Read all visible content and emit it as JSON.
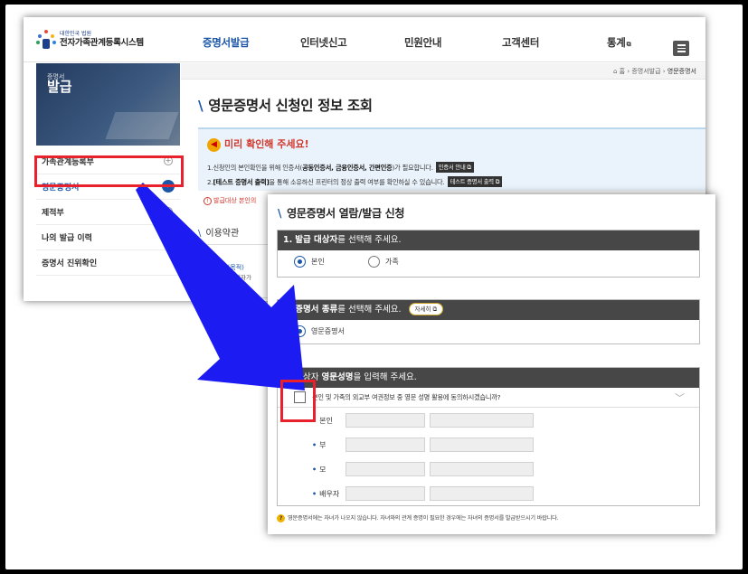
{
  "header": {
    "logo_small": "대한민국 법원",
    "logo_title": "전자가족관계등록시스템",
    "nav": [
      {
        "label": "증명서발급"
      },
      {
        "label": "인터넷신고"
      },
      {
        "label": "민원안내"
      },
      {
        "label": "고객센터"
      },
      {
        "label": "통계"
      }
    ],
    "ext_icon": "⧉"
  },
  "banner": {
    "small": "증명서",
    "big": "발급"
  },
  "sidebar": {
    "items": [
      {
        "label": "가족관계등록부"
      },
      {
        "label": "영문증명서"
      },
      {
        "label": "제적부"
      },
      {
        "label": "나의 발급 이력"
      },
      {
        "label": "증명서 진위확인"
      }
    ]
  },
  "breadcrumb": {
    "home": "홈",
    "level1": "증명서발급",
    "current": "영문증명서"
  },
  "page_title": "영문증명서 신청인 정보 조회",
  "notice": {
    "title": "미리 확인해 주세요!",
    "line1_a": "1.신청인의 본인확인을 위해 인증서(",
    "line1_b": "공동인증서, 금융인증서, 간편인증",
    "line1_c": ")가 필요합니다.",
    "line1_btn": "인증서 안내 ⧉",
    "line2_a": "2.",
    "line2_b": "[테스트 증명서 출력]",
    "line2_c": "을 통해 소유하신 프린터의 정상 출력 여부를 확인하실 수 있습니다.",
    "line2_btn": "테스트 증명서 출력 ⧉",
    "warn": "발급대상 본인의"
  },
  "terms": {
    "title": "이용약관",
    "article": "제1조 (목적)",
    "body": "이 약관은 전자가"
  },
  "form": {
    "title": "영문증명서 열람/발급 신청",
    "section1": {
      "num": "1.",
      "strong": "발급 대상자",
      "rest": "를 선택해 주세요.",
      "options": [
        {
          "label": "본인",
          "selected": true
        },
        {
          "label": "가족",
          "selected": false
        }
      ]
    },
    "section2": {
      "num": "2.",
      "strong": "증명서 종류",
      "rest": "를 선택해 주세요.",
      "detail_btn": "자세히 ⧉",
      "option": "영문증명서"
    },
    "section3": {
      "num": "3.",
      "pre": "대상자 ",
      "strong": "영문성명",
      "rest": "을 입력해 주세요.",
      "consent": "본인 및 가족의 외교부 여권정보 중 영문 성명 활용에 동의하시겠습니까?",
      "fields": [
        {
          "label": "본인"
        },
        {
          "label": "부"
        },
        {
          "label": "모"
        },
        {
          "label": "배우자"
        }
      ]
    },
    "footnote": "영문증명서에는 자녀가 나오지 않습니다. 자녀와의 관계 증명이 필요한 경우에는 자녀의 증명서를 발급받으시기 바랍니다."
  },
  "colors": {
    "accent": "#1a55a8",
    "highlight": "#e8212d",
    "arrow": "#1b1bf2",
    "panel_head": "#474747"
  }
}
